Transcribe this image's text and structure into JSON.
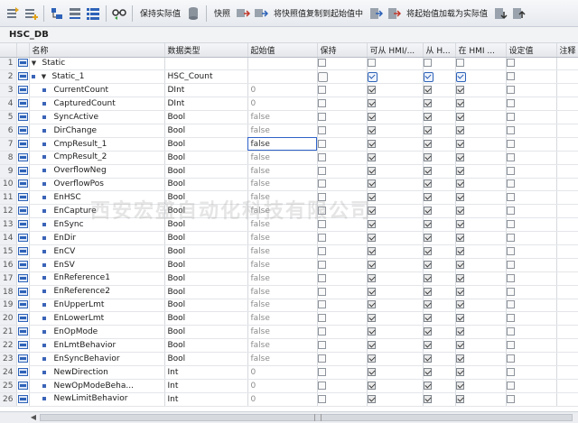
{
  "toolbar": {
    "retain_actual_label": "保持实际值",
    "snapshot_label": "快照",
    "copy_snapshot_label": "将快照值复制到起始值中",
    "load_start_label": "将起始值加载为实际值"
  },
  "block_name": "HSC_DB",
  "columns": {
    "name": "名称",
    "datatype": "数据类型",
    "start": "起始值",
    "retain": "保持",
    "hmi_access": "可从 HMI/...",
    "hmi_visible": "从 H...",
    "hmi_setpoint": "在 HMI ...",
    "setpoint": "设定值",
    "comment": "注释"
  },
  "rows": [
    {
      "num": "1",
      "level": 0,
      "arrow": "▼",
      "name": "Static",
      "type": "",
      "start": "",
      "retain": false,
      "hmi1": false,
      "hmi2": false,
      "hmi3": false
    },
    {
      "num": "2",
      "level": 1,
      "arrow": "▼",
      "name": "Static_1",
      "type": "HSC_Count",
      "start": "",
      "retain": false,
      "hmi1": true,
      "hmi2": true,
      "hmi3": true
    },
    {
      "num": "3",
      "level": 2,
      "arrow": "",
      "name": "CurrentCount",
      "type": "DInt",
      "start": "0",
      "retain": false,
      "hmi1": true,
      "hmi2": true,
      "hmi3": true
    },
    {
      "num": "4",
      "level": 2,
      "arrow": "",
      "name": "CapturedCount",
      "type": "DInt",
      "start": "0",
      "retain": false,
      "hmi1": true,
      "hmi2": true,
      "hmi3": true
    },
    {
      "num": "5",
      "level": 2,
      "arrow": "",
      "name": "SyncActive",
      "type": "Bool",
      "start": "false",
      "retain": false,
      "hmi1": true,
      "hmi2": true,
      "hmi3": true
    },
    {
      "num": "6",
      "level": 2,
      "arrow": "",
      "name": "DirChange",
      "type": "Bool",
      "start": "false",
      "retain": false,
      "hmi1": true,
      "hmi2": true,
      "hmi3": true
    },
    {
      "num": "7",
      "level": 2,
      "arrow": "",
      "name": "CmpResult_1",
      "type": "Bool",
      "start": "false",
      "retain": false,
      "hmi1": true,
      "hmi2": true,
      "hmi3": true
    },
    {
      "num": "8",
      "level": 2,
      "arrow": "",
      "name": "CmpResult_2",
      "type": "Bool",
      "start": "false",
      "retain": false,
      "hmi1": true,
      "hmi2": true,
      "hmi3": true
    },
    {
      "num": "9",
      "level": 2,
      "arrow": "",
      "name": "OverflowNeg",
      "type": "Bool",
      "start": "false",
      "retain": false,
      "hmi1": true,
      "hmi2": true,
      "hmi3": true
    },
    {
      "num": "10",
      "level": 2,
      "arrow": "",
      "name": "OverflowPos",
      "type": "Bool",
      "start": "false",
      "retain": false,
      "hmi1": true,
      "hmi2": true,
      "hmi3": true
    },
    {
      "num": "11",
      "level": 2,
      "arrow": "",
      "name": "EnHSC",
      "type": "Bool",
      "start": "false",
      "retain": false,
      "hmi1": true,
      "hmi2": true,
      "hmi3": true
    },
    {
      "num": "12",
      "level": 2,
      "arrow": "",
      "name": "EnCapture",
      "type": "Bool",
      "start": "false",
      "retain": false,
      "hmi1": true,
      "hmi2": true,
      "hmi3": true
    },
    {
      "num": "13",
      "level": 2,
      "arrow": "",
      "name": "EnSync",
      "type": "Bool",
      "start": "false",
      "retain": false,
      "hmi1": true,
      "hmi2": true,
      "hmi3": true
    },
    {
      "num": "14",
      "level": 2,
      "arrow": "",
      "name": "EnDir",
      "type": "Bool",
      "start": "false",
      "retain": false,
      "hmi1": true,
      "hmi2": true,
      "hmi3": true
    },
    {
      "num": "15",
      "level": 2,
      "arrow": "",
      "name": "EnCV",
      "type": "Bool",
      "start": "false",
      "retain": false,
      "hmi1": true,
      "hmi2": true,
      "hmi3": true
    },
    {
      "num": "16",
      "level": 2,
      "arrow": "",
      "name": "EnSV",
      "type": "Bool",
      "start": "false",
      "retain": false,
      "hmi1": true,
      "hmi2": true,
      "hmi3": true
    },
    {
      "num": "17",
      "level": 2,
      "arrow": "",
      "name": "EnReference1",
      "type": "Bool",
      "start": "false",
      "retain": false,
      "hmi1": true,
      "hmi2": true,
      "hmi3": true
    },
    {
      "num": "18",
      "level": 2,
      "arrow": "",
      "name": "EnReference2",
      "type": "Bool",
      "start": "false",
      "retain": false,
      "hmi1": true,
      "hmi2": true,
      "hmi3": true
    },
    {
      "num": "19",
      "level": 2,
      "arrow": "",
      "name": "EnUpperLmt",
      "type": "Bool",
      "start": "false",
      "retain": false,
      "hmi1": true,
      "hmi2": true,
      "hmi3": true
    },
    {
      "num": "20",
      "level": 2,
      "arrow": "",
      "name": "EnLowerLmt",
      "type": "Bool",
      "start": "false",
      "retain": false,
      "hmi1": true,
      "hmi2": true,
      "hmi3": true
    },
    {
      "num": "21",
      "level": 2,
      "arrow": "",
      "name": "EnOpMode",
      "type": "Bool",
      "start": "false",
      "retain": false,
      "hmi1": true,
      "hmi2": true,
      "hmi3": true
    },
    {
      "num": "22",
      "level": 2,
      "arrow": "",
      "name": "EnLmtBehavior",
      "type": "Bool",
      "start": "false",
      "retain": false,
      "hmi1": true,
      "hmi2": true,
      "hmi3": true
    },
    {
      "num": "23",
      "level": 2,
      "arrow": "",
      "name": "EnSyncBehavior",
      "type": "Bool",
      "start": "false",
      "retain": false,
      "hmi1": true,
      "hmi2": true,
      "hmi3": true
    },
    {
      "num": "24",
      "level": 2,
      "arrow": "",
      "name": "NewDirection",
      "type": "Int",
      "start": "0",
      "retain": false,
      "hmi1": true,
      "hmi2": true,
      "hmi3": true
    },
    {
      "num": "25",
      "level": 2,
      "arrow": "",
      "name": "NewOpModeBeha...",
      "type": "Int",
      "start": "0",
      "retain": false,
      "hmi1": true,
      "hmi2": true,
      "hmi3": true
    },
    {
      "num": "26",
      "level": 2,
      "arrow": "",
      "name": "NewLimitBehavior",
      "type": "Int",
      "start": "0",
      "retain": false,
      "hmi1": true,
      "hmi2": true,
      "hmi3": true
    }
  ],
  "watermark": "西安宏盛自动化科技有限公司",
  "colors": {
    "accent": "#2d62b8",
    "toolbar_bg": "#e6e9ee",
    "header_bg": "#e4e7eb"
  }
}
